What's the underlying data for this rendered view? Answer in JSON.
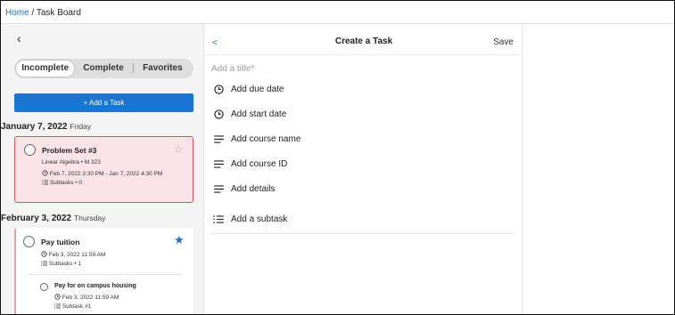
{
  "breadcrumb": {
    "home": "Home",
    "separator": "/",
    "current": "Task Board"
  },
  "left_panel": {
    "back_label": "‹",
    "tabs": [
      {
        "label": "Incomplete",
        "active": true
      },
      {
        "label": "Complete",
        "active": false
      },
      {
        "label": "Favorites",
        "active": false
      }
    ],
    "add_task_label": "+   Add a Task",
    "groups": [
      {
        "date": "January 7, 2022",
        "weekday": "Friday",
        "tasks": [
          {
            "title": "Problem Set #3",
            "course": "Linear Algebra • M 323",
            "time": "Feb 7, 2022 3:30 PM - Jan 7, 2022 4:30 PM",
            "subtasks": "Subtasks • 0",
            "favorite": false
          }
        ]
      },
      {
        "date": "February 3, 2022",
        "weekday": "Thursday",
        "tasks": [
          {
            "title": "Pay tuition",
            "time": "Feb 3, 2022 11:59 AM",
            "subtasks": "Subtasks • 1",
            "favorite": true,
            "children": [
              {
                "title": "Pay for on campus housing",
                "time": "Feb 3, 2022 11:59 AM",
                "subtasks": "Subtask #1"
              }
            ]
          }
        ]
      }
    ]
  },
  "form": {
    "back_label": "<",
    "title": "Create a Task",
    "save_label": "Save",
    "title_placeholder": "Add a title*",
    "fields": [
      {
        "label": "Add due date",
        "icon": "clock-icon"
      },
      {
        "label": "Add start date",
        "icon": "clock-icon"
      },
      {
        "label": "Add course name",
        "icon": "lines-icon"
      },
      {
        "label": "Add course ID",
        "icon": "lines-icon"
      },
      {
        "label": "Add details",
        "icon": "lines-icon"
      },
      {
        "label": "Add a subtask",
        "icon": "list-icon"
      }
    ]
  },
  "colors": {
    "accent": "#1976d2",
    "overdue_bg": "#fbe4e7",
    "overdue_border": "#d9535f"
  }
}
